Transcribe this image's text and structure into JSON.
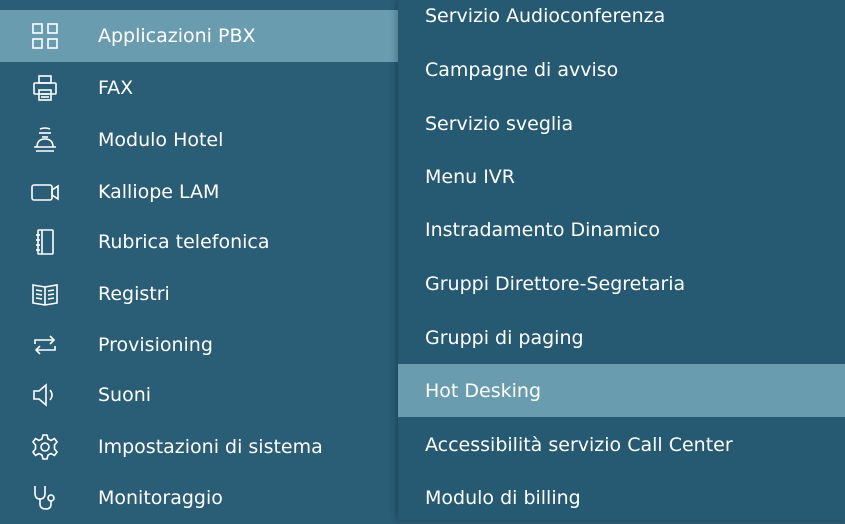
{
  "sidebar": {
    "items": [
      {
        "label": "Applicazioni PBX",
        "icon": "grid-icon",
        "active": true
      },
      {
        "label": "FAX",
        "icon": "printer-icon"
      },
      {
        "label": "Modulo Hotel",
        "icon": "hotel-bell-icon"
      },
      {
        "label": "Kalliope LAM",
        "icon": "video-camera-icon"
      },
      {
        "label": "Rubrica telefonica",
        "icon": "address-book-icon"
      },
      {
        "label": "Registri",
        "icon": "open-book-icon"
      },
      {
        "label": "Provisioning",
        "icon": "sync-arrows-icon"
      },
      {
        "label": "Suoni",
        "icon": "speaker-icon"
      },
      {
        "label": "Impostazioni di sistema",
        "icon": "gear-icon"
      },
      {
        "label": "Monitoraggio",
        "icon": "stethoscope-icon"
      }
    ]
  },
  "submenu": {
    "items": [
      {
        "label": "Servizio Audioconferenza"
      },
      {
        "label": "Campagne di avviso"
      },
      {
        "label": "Servizio sveglia"
      },
      {
        "label": "Menu IVR"
      },
      {
        "label": "Instradamento Dinamico"
      },
      {
        "label": "Gruppi Direttore-Segretaria"
      },
      {
        "label": "Gruppi di paging"
      },
      {
        "label": "Hot Desking",
        "active": true
      },
      {
        "label": "Accessibilità servizio Call Center"
      },
      {
        "label": "Modulo di billing"
      }
    ]
  },
  "colors": {
    "background": "#2a5d76",
    "submenu_background": "#255a72",
    "active": "#6a9cb0",
    "text": "#ffffff"
  }
}
